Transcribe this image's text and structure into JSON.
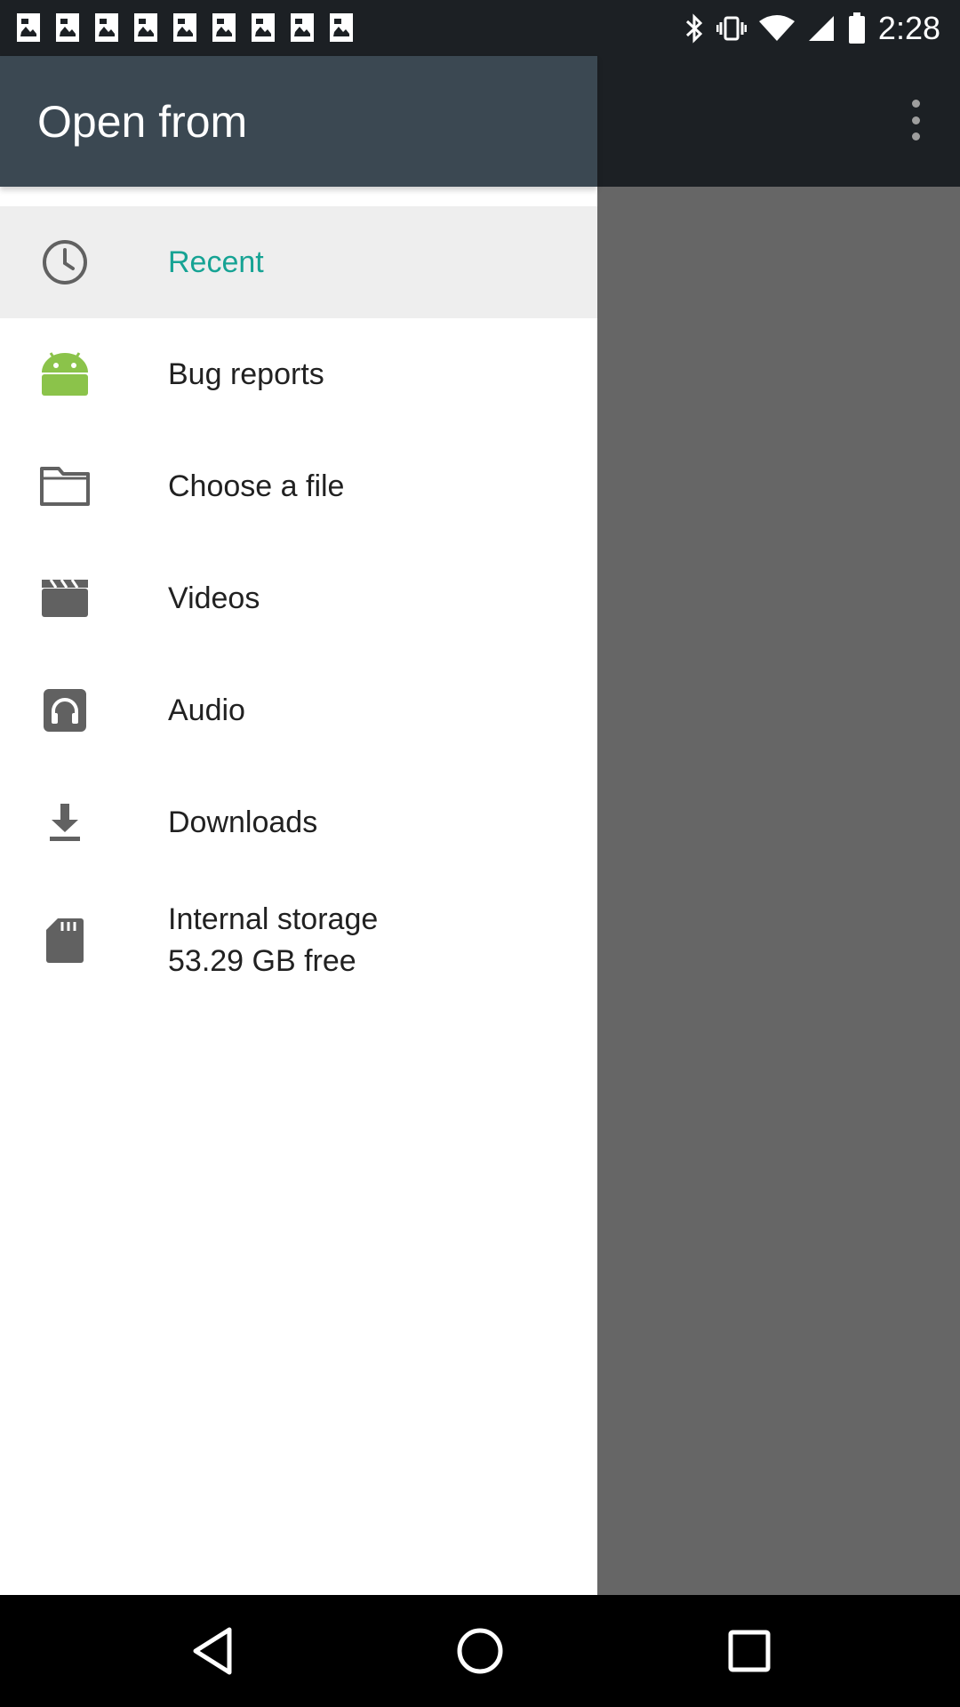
{
  "status_bar": {
    "time": "2:28",
    "left_icons": [
      "image-icon",
      "image-icon",
      "image-icon",
      "image-icon",
      "image-icon",
      "image-icon",
      "image-icon",
      "image-icon",
      "image-icon"
    ],
    "right_icons": [
      "bluetooth-icon",
      "vibrate-icon",
      "wifi-icon",
      "signal-icon",
      "battery-icon"
    ]
  },
  "drawer": {
    "title": "Open from",
    "items": [
      {
        "label": "Recent",
        "icon": "clock-icon",
        "selected": true
      },
      {
        "label": "Bug reports",
        "icon": "android-icon"
      },
      {
        "label": "Choose a file",
        "icon": "folder-icon"
      },
      {
        "label": "Videos",
        "icon": "clapperboard-icon"
      },
      {
        "label": "Audio",
        "icon": "headphones-icon"
      },
      {
        "label": "Downloads",
        "icon": "download-icon"
      },
      {
        "label": "Internal storage",
        "sublabel": "53.29 GB free",
        "icon": "sd-card-icon"
      }
    ]
  },
  "colors": {
    "drawer_header": "#3b4852",
    "selected_text": "#16a394",
    "selected_bg": "#eeeeee",
    "icon_gray": "#616161",
    "android_green": "#8bc34a",
    "scrim": "#666666"
  },
  "nav_bar": {
    "buttons": [
      "back-icon",
      "home-icon",
      "recents-icon"
    ]
  }
}
